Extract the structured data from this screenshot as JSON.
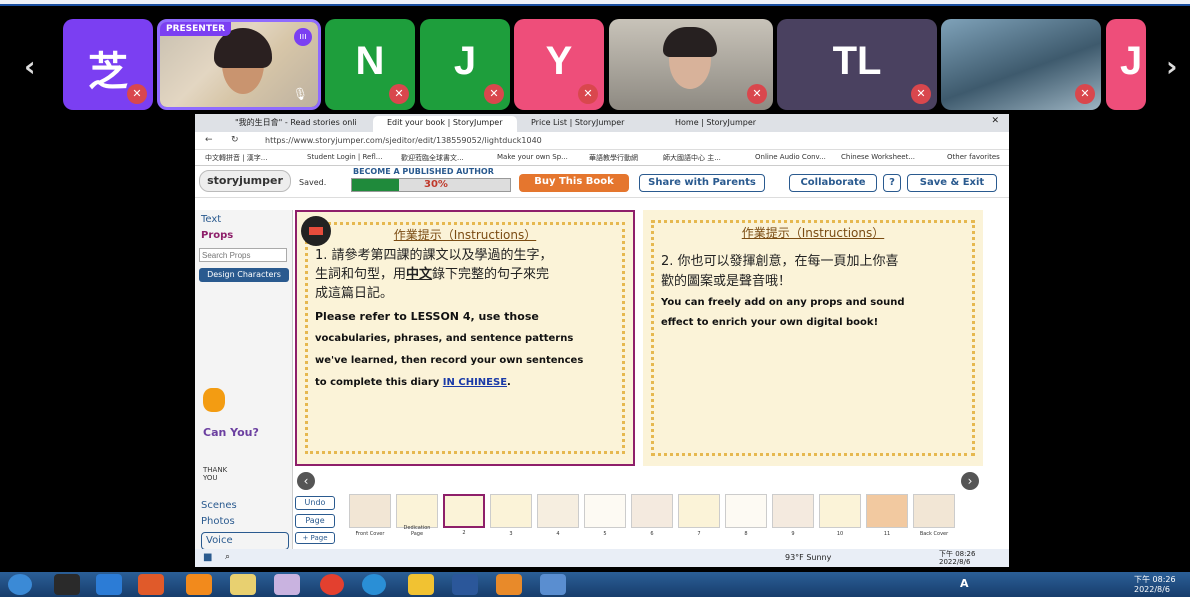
{
  "gallery": {
    "prev_arrow": "‹",
    "next_arrow": "›",
    "presenter_badge": "PRESENTER",
    "tiles": [
      {
        "letter": "芝",
        "color": "#7b3ff2"
      },
      {
        "letter": "",
        "color": "#3a3a3a"
      },
      {
        "letter": "N",
        "color": "#1e9e3c"
      },
      {
        "letter": "J",
        "color": "#1e9e3c"
      },
      {
        "letter": "Y",
        "color": "#ee4e7a"
      },
      {
        "letter": "",
        "color": "#6a6a6a"
      },
      {
        "letter": "TL",
        "color": "#4a4160"
      },
      {
        "letter": "",
        "color": "#4d6a7e"
      },
      {
        "letter": "J",
        "color": "#ee4e7a"
      }
    ]
  },
  "browser": {
    "tabs": [
      "\"我的生日會\" - Read stories onli",
      "Edit your book | StoryJumper",
      "Price List | StoryJumper",
      "Home | StoryJumper"
    ],
    "url": "https://www.storyjumper.com/sjeditor/edit/138559052/lightduck1040",
    "favorites": [
      "中文轉拼音 | 漢字...",
      "Student Login | Refl...",
      "歡迎蒞臨全球書文...",
      "Make your own Sp...",
      "華語教學行動網",
      "師大國語中心 主...",
      "Online Audio Conv...",
      "Chinese Worksheet...",
      "Other favorites"
    ]
  },
  "storyjumper": {
    "logo": "storyjumper",
    "saved": "Saved.",
    "become_author": "BECOME A PUBLISHED AUTHOR",
    "progress_label": "30%",
    "progress_value": 0.3,
    "buy_label": "Buy This Book",
    "share_label": "Share with Parents",
    "collab_label": "Collaborate",
    "help_label": "?",
    "save_exit_label": "Save & Exit"
  },
  "left_panel": {
    "text_label": "Text",
    "props_label": "Props",
    "search_placeholder": "Search Props",
    "design_label": "Design Characters",
    "scenes_label": "Scenes",
    "photos_label": "Photos",
    "voice_label": "Voice",
    "props": [
      "Can You?",
      "THANK YOU"
    ]
  },
  "page_left": {
    "title": "作業提示（Instructions）",
    "zh_line1": "1. 請參考第四課的課文以及學過的生字，",
    "zh_line2_pre": "生詞和句型，用",
    "zh_line2_bold": "中文",
    "zh_line2_post": "錄下完整的句子來完",
    "zh_line3": "成這篇日記。",
    "en_line1": "Please refer to LESSON 4, use those",
    "en_line2": "vocabularies, phrases, and sentence patterns",
    "en_line3": "we've learned, then record your own sentences",
    "en_line4_pre": "to complete this diary ",
    "en_line4_link": "IN CHINESE",
    "en_line4_post": "."
  },
  "page_right": {
    "title": "作業提示（Instructions）",
    "zh_line1": "2. 你也可以發揮創意，在每一頁加上你喜",
    "zh_line2": "歡的圖案或是聲音哦！",
    "en_line1": "You can freely add on any props and sound",
    "en_line2": "effect to enrich your own digital book!"
  },
  "thumbnails": {
    "undo_label": "Undo",
    "page_label": "Page",
    "add_page_label": "+ Page",
    "labels": [
      "Front Cover",
      "Dedication Page",
      "2",
      "3",
      "4",
      "5",
      "6",
      "7",
      "8",
      "9",
      "10",
      "11",
      "Back Cover"
    ]
  },
  "win_taskbar": {
    "weather": "93°F  Sunny",
    "time": "下午 08:26",
    "date": "2022/8/6"
  },
  "host_taskbar": {
    "time": "下午 08:26",
    "date": "2022/8/6",
    "ime": "A"
  }
}
